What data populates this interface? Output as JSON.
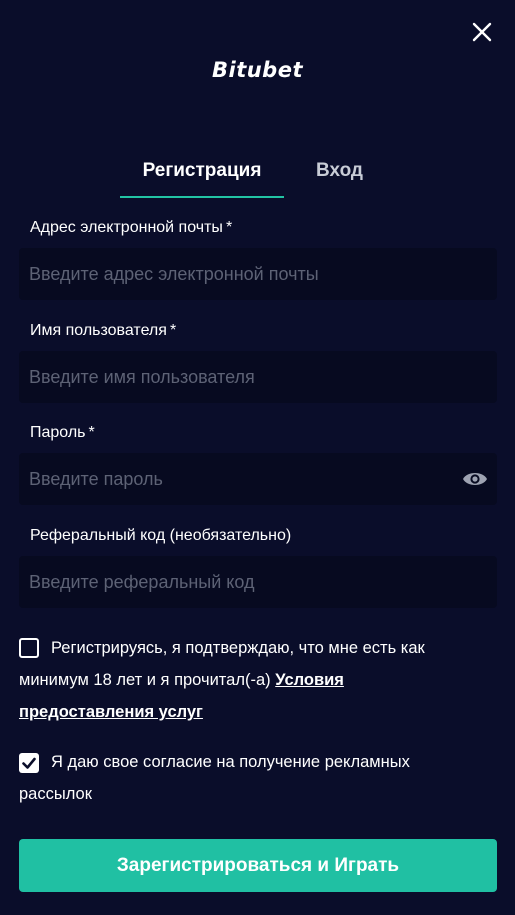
{
  "logo": {
    "text": "Bitubet"
  },
  "tabs": [
    {
      "label": "Регистрация",
      "active": true
    },
    {
      "label": "Вход",
      "active": false
    }
  ],
  "form": {
    "email": {
      "label": "Адрес электронной почты",
      "required_mark": "*",
      "placeholder": "Введите адрес электронной почты",
      "value": ""
    },
    "username": {
      "label": "Имя пользователя",
      "required_mark": "*",
      "placeholder": "Введите имя пользователя",
      "value": ""
    },
    "password": {
      "label": "Пароль",
      "required_mark": "*",
      "placeholder": "Введите пароль",
      "value": ""
    },
    "referral": {
      "label": "Реферальный код (необязательно)",
      "placeholder": "Введите реферальный код",
      "value": ""
    }
  },
  "consents": {
    "age": {
      "checked": false,
      "text": "Регистрируясь, я подтверждаю, что мне есть как минимум 18 лет и я прочитал(-а) ",
      "link": "Условия предоставления услуг"
    },
    "marketing": {
      "checked": true,
      "text": "Я даю свое согласие на получение рекламных рассылок"
    }
  },
  "submit": {
    "label": "Зарегистрироваться и Играть"
  },
  "colors": {
    "background": "#0a0d2a",
    "input_bg": "#070a20",
    "accent": "#20c0a3",
    "placeholder": "#5d6275"
  },
  "icons": {
    "close": "close-icon",
    "password_visibility": "eye-icon",
    "checkmark": "checkmark-icon"
  }
}
